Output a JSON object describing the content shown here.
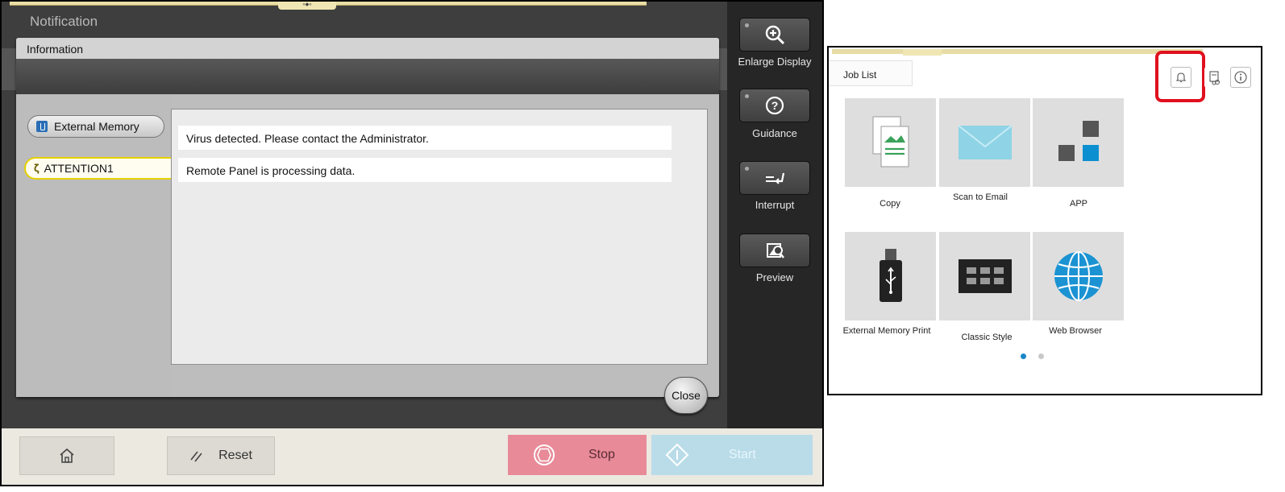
{
  "left_panel": {
    "topstrip_tab_text": "«◆»",
    "notification_title": "Notification",
    "info_window": {
      "title": "Information",
      "side_buttons": {
        "external_memory": "External Memory",
        "attention": "ATTENTION1"
      },
      "messages": [
        "Virus detected. Please contact the Administrator.",
        "Remote Panel is processing data."
      ],
      "close_label": "Close"
    },
    "right_buttons": {
      "enlarge_display": "Enlarge Display",
      "guidance": "Guidance",
      "interrupt": "Interrupt",
      "preview": "Preview"
    },
    "bottom_bar": {
      "reset_label": "Reset",
      "stop_label": "Stop",
      "start_label": "Start"
    },
    "colors": {
      "stop": "#e88a98",
      "start": "#b9dce8",
      "attention_border": "#e6d100"
    }
  },
  "right_panel": {
    "job_list_label": "Job List",
    "toolbar_icons": [
      "bell-icon",
      "device-icon",
      "info-icon"
    ],
    "tiles": {
      "copy": "Copy",
      "scan_to_email": "Scan to Email",
      "app": "APP",
      "external_memory_print": "External Memory Print",
      "classic_style": "Classic Style",
      "web_browser": "Web Browser"
    },
    "pager": {
      "active_page": 1,
      "total_pages": 2
    },
    "colors": {
      "highlight": "#e0101e",
      "pager_active": "#1a86c7",
      "pager_inactive": "#c8c8c8"
    }
  }
}
